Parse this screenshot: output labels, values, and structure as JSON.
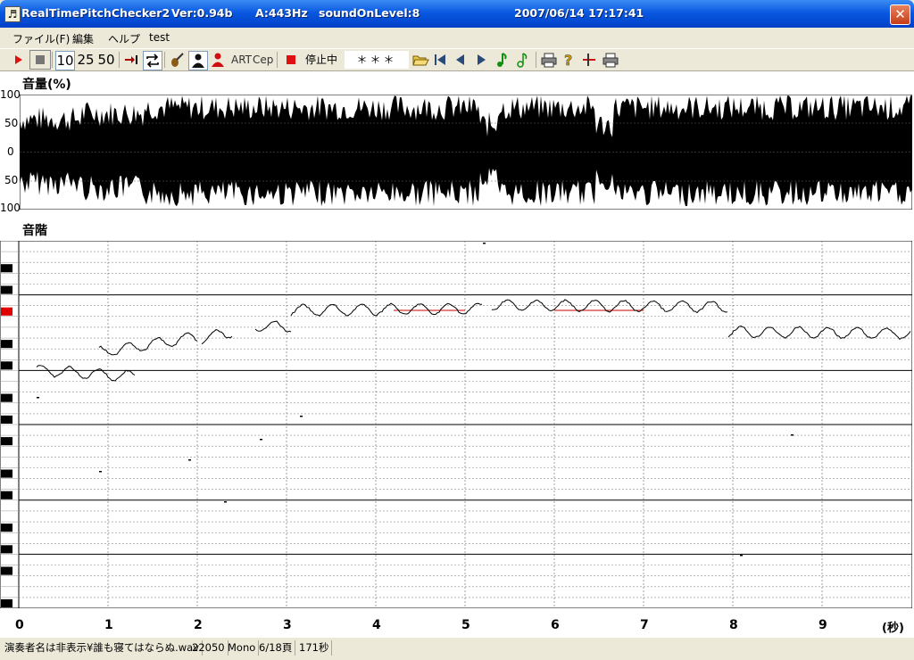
{
  "title": {
    "app_name": "RealTimePitchChecker2",
    "version": "Ver:0.94b",
    "a_freq": "A:443Hz",
    "sound_level": "soundOnLevel:8",
    "datetime": "2007/06/14 17:17:41"
  },
  "menu": [
    "ファイル(F)",
    "編集",
    "ヘルプ",
    "test"
  ],
  "toolbar": {
    "speed_10": "10",
    "speed_25": "25",
    "speed_50": "50",
    "art": "ART",
    "cep": "Cep",
    "status": "停止中",
    "note_display": "＊＊＊"
  },
  "volume_panel": {
    "label": "音量(%)",
    "y_ticks": [
      "100",
      "50",
      "0",
      "50",
      "100"
    ]
  },
  "pitch_panel": {
    "label": "音階",
    "x_ticks": [
      "0",
      "1",
      "2",
      "3",
      "4",
      "5",
      "6",
      "7",
      "8",
      "9"
    ],
    "x_unit": "(秒)"
  },
  "status_bar": {
    "file": "演奏者名は非表示¥誰も寝てはならぬ.wav",
    "rate": "22050",
    "channels": "Mono",
    "page": "6/18頁",
    "duration": "171秒"
  },
  "colors": {
    "titlebar": "#0a58e0",
    "waveform": "#000000",
    "pitch_line": "#000000",
    "target_line": "#cc0000",
    "active_key": "#e00000"
  }
}
